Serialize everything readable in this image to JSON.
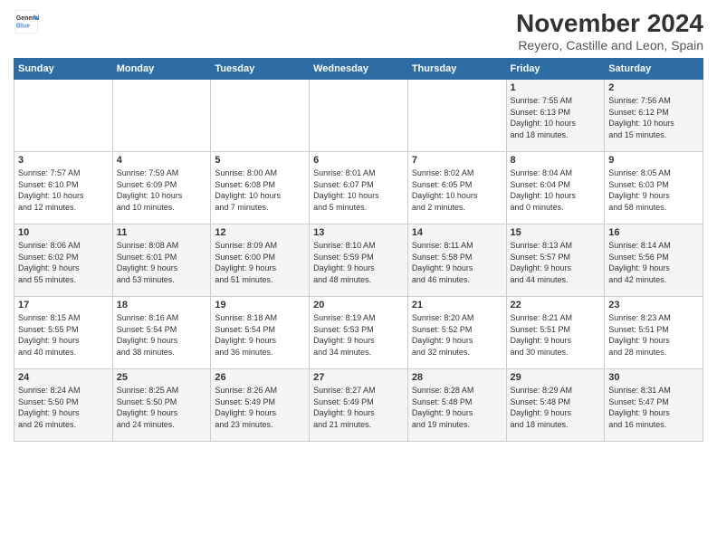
{
  "logo": {
    "line1": "General",
    "line2": "Blue"
  },
  "title": "November 2024",
  "location": "Reyero, Castille and Leon, Spain",
  "weekdays": [
    "Sunday",
    "Monday",
    "Tuesday",
    "Wednesday",
    "Thursday",
    "Friday",
    "Saturday"
  ],
  "weeks": [
    [
      {
        "day": "",
        "content": ""
      },
      {
        "day": "",
        "content": ""
      },
      {
        "day": "",
        "content": ""
      },
      {
        "day": "",
        "content": ""
      },
      {
        "day": "",
        "content": ""
      },
      {
        "day": "1",
        "content": "Sunrise: 7:55 AM\nSunset: 6:13 PM\nDaylight: 10 hours\nand 18 minutes."
      },
      {
        "day": "2",
        "content": "Sunrise: 7:56 AM\nSunset: 6:12 PM\nDaylight: 10 hours\nand 15 minutes."
      }
    ],
    [
      {
        "day": "3",
        "content": "Sunrise: 7:57 AM\nSunset: 6:10 PM\nDaylight: 10 hours\nand 12 minutes."
      },
      {
        "day": "4",
        "content": "Sunrise: 7:59 AM\nSunset: 6:09 PM\nDaylight: 10 hours\nand 10 minutes."
      },
      {
        "day": "5",
        "content": "Sunrise: 8:00 AM\nSunset: 6:08 PM\nDaylight: 10 hours\nand 7 minutes."
      },
      {
        "day": "6",
        "content": "Sunrise: 8:01 AM\nSunset: 6:07 PM\nDaylight: 10 hours\nand 5 minutes."
      },
      {
        "day": "7",
        "content": "Sunrise: 8:02 AM\nSunset: 6:05 PM\nDaylight: 10 hours\nand 2 minutes."
      },
      {
        "day": "8",
        "content": "Sunrise: 8:04 AM\nSunset: 6:04 PM\nDaylight: 10 hours\nand 0 minutes."
      },
      {
        "day": "9",
        "content": "Sunrise: 8:05 AM\nSunset: 6:03 PM\nDaylight: 9 hours\nand 58 minutes."
      }
    ],
    [
      {
        "day": "10",
        "content": "Sunrise: 8:06 AM\nSunset: 6:02 PM\nDaylight: 9 hours\nand 55 minutes."
      },
      {
        "day": "11",
        "content": "Sunrise: 8:08 AM\nSunset: 6:01 PM\nDaylight: 9 hours\nand 53 minutes."
      },
      {
        "day": "12",
        "content": "Sunrise: 8:09 AM\nSunset: 6:00 PM\nDaylight: 9 hours\nand 51 minutes."
      },
      {
        "day": "13",
        "content": "Sunrise: 8:10 AM\nSunset: 5:59 PM\nDaylight: 9 hours\nand 48 minutes."
      },
      {
        "day": "14",
        "content": "Sunrise: 8:11 AM\nSunset: 5:58 PM\nDaylight: 9 hours\nand 46 minutes."
      },
      {
        "day": "15",
        "content": "Sunrise: 8:13 AM\nSunset: 5:57 PM\nDaylight: 9 hours\nand 44 minutes."
      },
      {
        "day": "16",
        "content": "Sunrise: 8:14 AM\nSunset: 5:56 PM\nDaylight: 9 hours\nand 42 minutes."
      }
    ],
    [
      {
        "day": "17",
        "content": "Sunrise: 8:15 AM\nSunset: 5:55 PM\nDaylight: 9 hours\nand 40 minutes."
      },
      {
        "day": "18",
        "content": "Sunrise: 8:16 AM\nSunset: 5:54 PM\nDaylight: 9 hours\nand 38 minutes."
      },
      {
        "day": "19",
        "content": "Sunrise: 8:18 AM\nSunset: 5:54 PM\nDaylight: 9 hours\nand 36 minutes."
      },
      {
        "day": "20",
        "content": "Sunrise: 8:19 AM\nSunset: 5:53 PM\nDaylight: 9 hours\nand 34 minutes."
      },
      {
        "day": "21",
        "content": "Sunrise: 8:20 AM\nSunset: 5:52 PM\nDaylight: 9 hours\nand 32 minutes."
      },
      {
        "day": "22",
        "content": "Sunrise: 8:21 AM\nSunset: 5:51 PM\nDaylight: 9 hours\nand 30 minutes."
      },
      {
        "day": "23",
        "content": "Sunrise: 8:23 AM\nSunset: 5:51 PM\nDaylight: 9 hours\nand 28 minutes."
      }
    ],
    [
      {
        "day": "24",
        "content": "Sunrise: 8:24 AM\nSunset: 5:50 PM\nDaylight: 9 hours\nand 26 minutes."
      },
      {
        "day": "25",
        "content": "Sunrise: 8:25 AM\nSunset: 5:50 PM\nDaylight: 9 hours\nand 24 minutes."
      },
      {
        "day": "26",
        "content": "Sunrise: 8:26 AM\nSunset: 5:49 PM\nDaylight: 9 hours\nand 23 minutes."
      },
      {
        "day": "27",
        "content": "Sunrise: 8:27 AM\nSunset: 5:49 PM\nDaylight: 9 hours\nand 21 minutes."
      },
      {
        "day": "28",
        "content": "Sunrise: 8:28 AM\nSunset: 5:48 PM\nDaylight: 9 hours\nand 19 minutes."
      },
      {
        "day": "29",
        "content": "Sunrise: 8:29 AM\nSunset: 5:48 PM\nDaylight: 9 hours\nand 18 minutes."
      },
      {
        "day": "30",
        "content": "Sunrise: 8:31 AM\nSunset: 5:47 PM\nDaylight: 9 hours\nand 16 minutes."
      }
    ]
  ]
}
